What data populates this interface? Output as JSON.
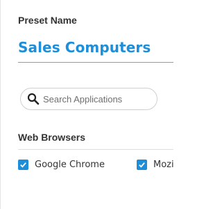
{
  "preset": {
    "label": "Preset Name",
    "value": "Sales Computers"
  },
  "search": {
    "placeholder": "Search Applications",
    "icon": "search-icon"
  },
  "category": {
    "title": "Web Browsers",
    "items": [
      {
        "label": "Google Chrome",
        "checked": true
      },
      {
        "label": "Mozi",
        "checked": true
      }
    ]
  },
  "colors": {
    "accent": "#1f8ed8",
    "text": "#333333"
  }
}
